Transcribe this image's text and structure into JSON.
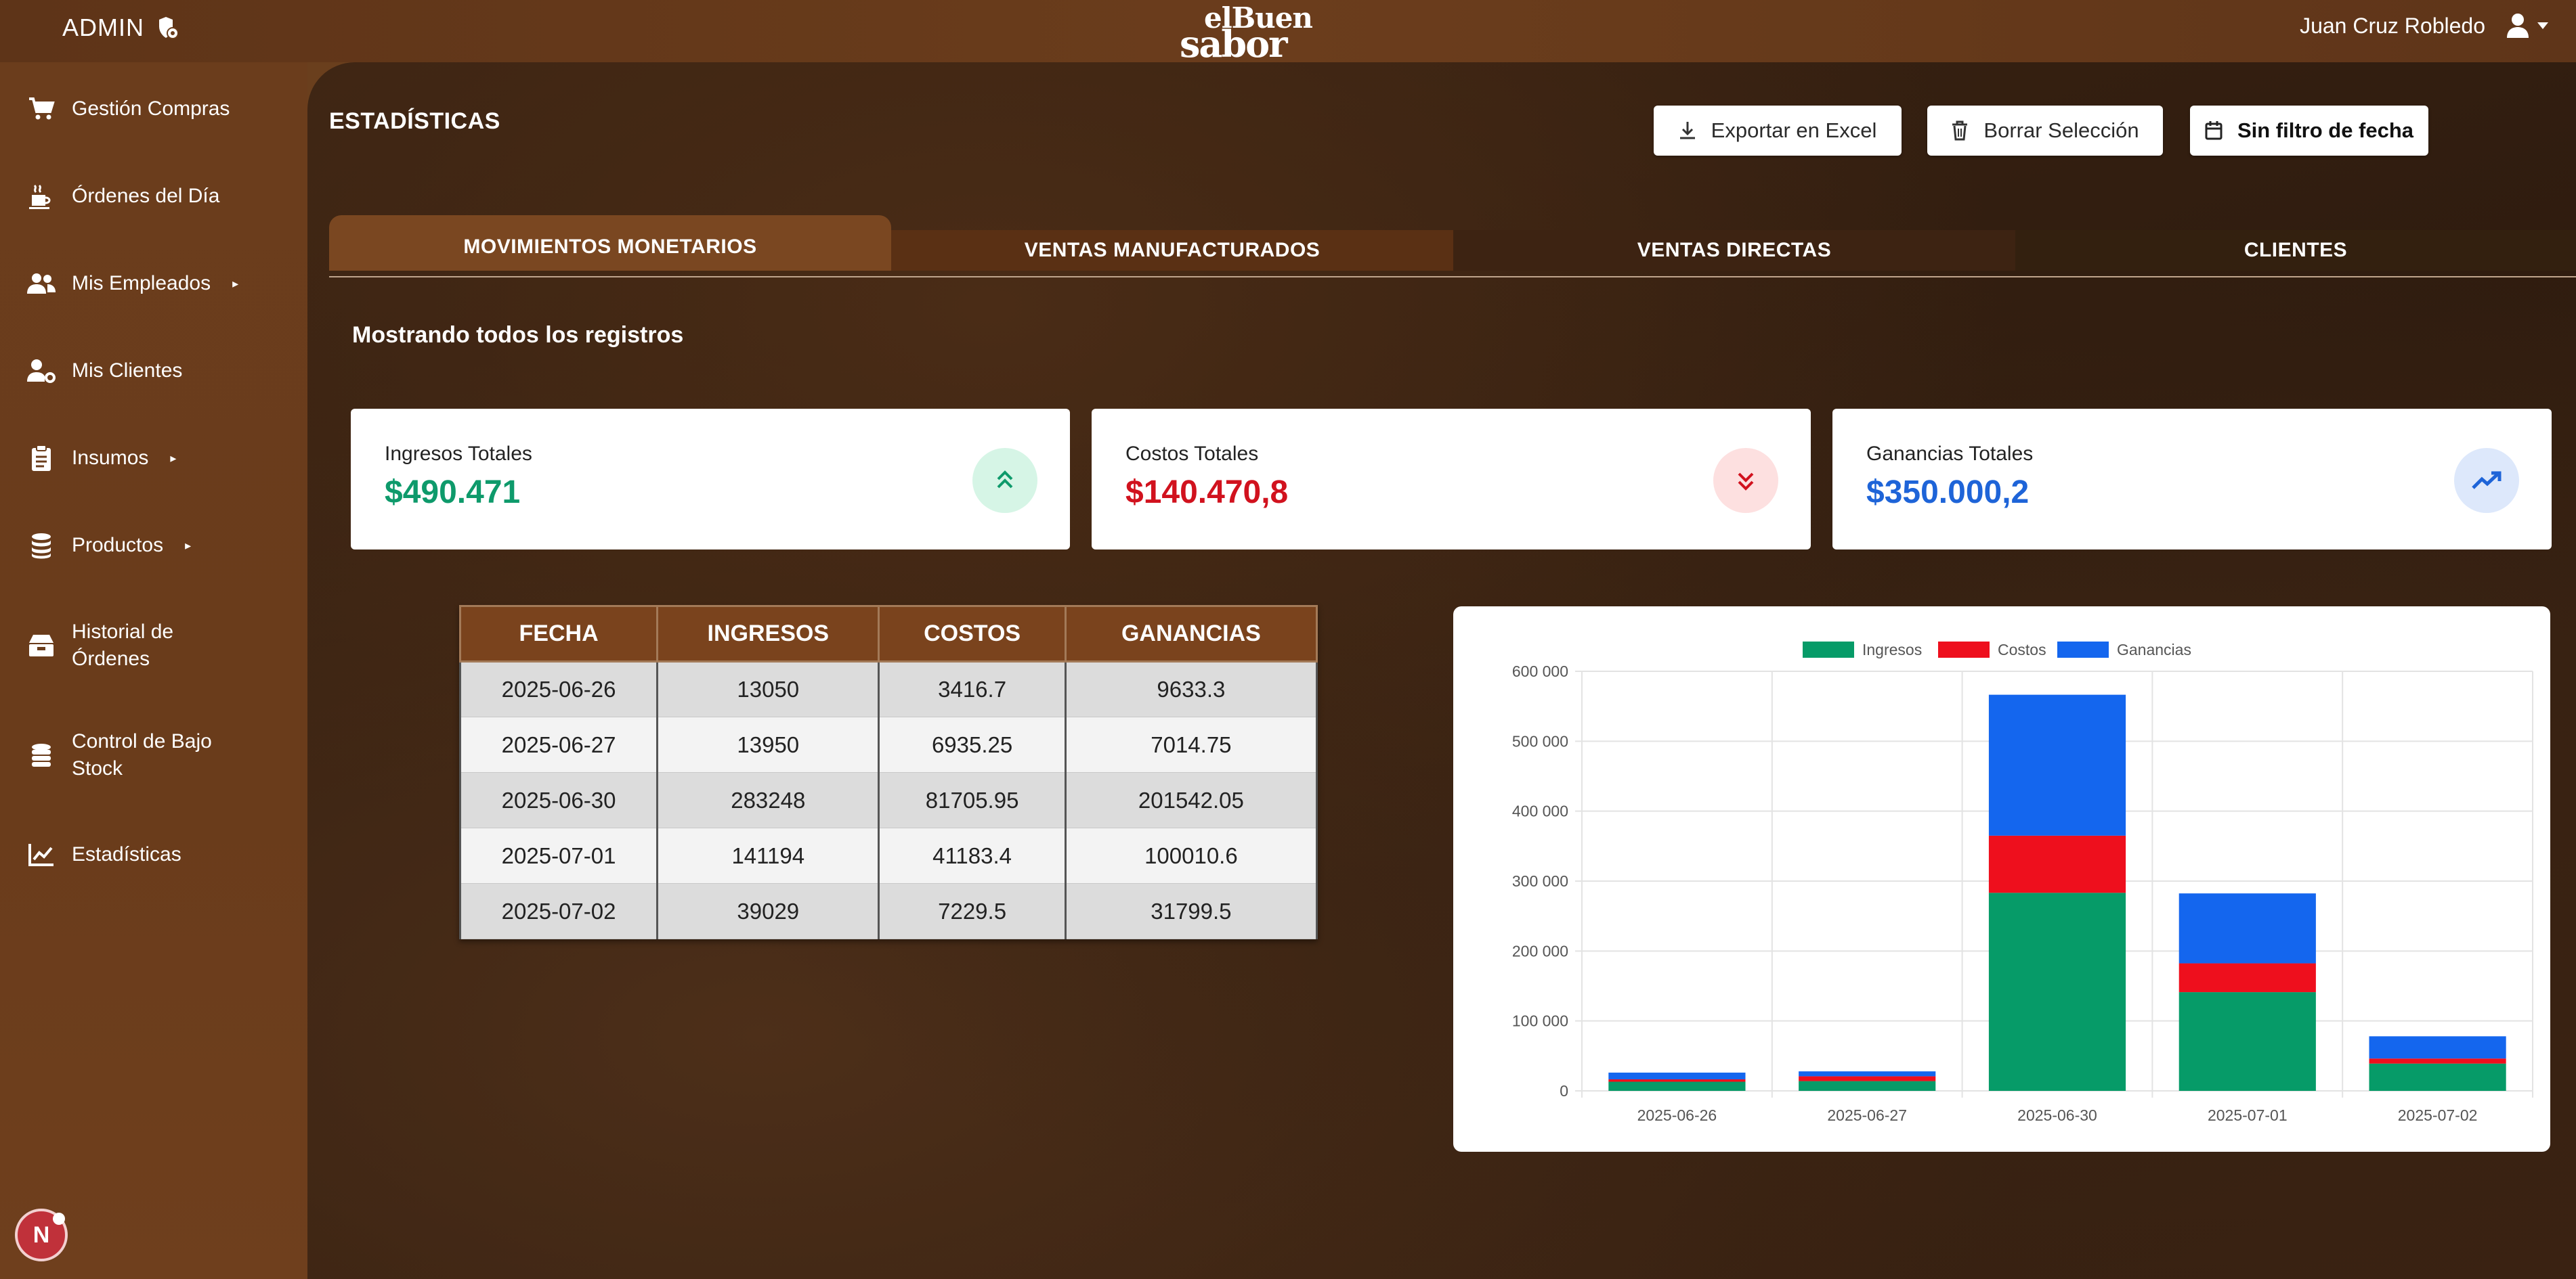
{
  "header": {
    "admin_label": "ADMIN",
    "logo_line1": "elBuen",
    "logo_line2": "sabor",
    "user_name": "Juan Cruz Robledo"
  },
  "sidebar": {
    "items": [
      {
        "label": "Gestión Compras",
        "icon": "cart-icon"
      },
      {
        "label": "Órdenes del Día",
        "icon": "kitchen-icon"
      },
      {
        "label": "Mis Empleados",
        "icon": "users-icon",
        "has_submenu": true
      },
      {
        "label": "Mis Clientes",
        "icon": "user-gear-icon"
      },
      {
        "label": "Insumos",
        "icon": "clipboard-icon",
        "has_submenu": true
      },
      {
        "label": "Productos",
        "icon": "coins-icon",
        "has_submenu": true
      },
      {
        "label": "Historial de Órdenes",
        "icon": "box-icon"
      },
      {
        "label": "Control de Bajo Stock",
        "icon": "stack-icon"
      },
      {
        "label": "Estadísticas",
        "icon": "chart-line-icon"
      }
    ],
    "submenu_arrow": "▸",
    "badge_letter": "N"
  },
  "page": {
    "title": "ESTADÍSTICAS",
    "buttons": {
      "export": "Exportar en Excel",
      "clear": "Borrar Selección",
      "date_filter": "Sin filtro de fecha"
    },
    "tabs": [
      "MOVIMIENTOS MONETARIOS",
      "VENTAS MANUFACTURADOS",
      "VENTAS DIRECTAS",
      "CLIENTES"
    ],
    "showing_text": "Mostrando todos los registros"
  },
  "cards": [
    {
      "label": "Ingresos Totales",
      "value": "$490.471",
      "color": "#0e9a6b",
      "icon_bg": "#d6f5e6",
      "icon": "double-chevron-up-icon"
    },
    {
      "label": "Costos Totales",
      "value": "$140.470,8",
      "color": "#d1121e",
      "icon_bg": "#fde0e0",
      "icon": "double-chevron-down-icon"
    },
    {
      "label": "Ganancias Totales",
      "value": "$350.000,2",
      "color": "#1e64d8",
      "icon_bg": "#dde8fb",
      "icon": "trend-up-icon"
    }
  ],
  "table": {
    "headers": [
      "FECHA",
      "INGRESOS",
      "COSTOS",
      "GANANCIAS"
    ],
    "rows": [
      [
        "2025-06-26",
        "13050",
        "3416.7",
        "9633.3"
      ],
      [
        "2025-06-27",
        "13950",
        "6935.25",
        "7014.75"
      ],
      [
        "2025-06-30",
        "283248",
        "81705.95",
        "201542.05"
      ],
      [
        "2025-07-01",
        "141194",
        "41183.4",
        "100010.6"
      ],
      [
        "2025-07-02",
        "39029",
        "7229.5",
        "31799.5"
      ]
    ]
  },
  "chart_data": {
    "type": "bar",
    "stacked": true,
    "categories": [
      "2025-06-26",
      "2025-06-27",
      "2025-06-30",
      "2025-07-01",
      "2025-07-02"
    ],
    "series": [
      {
        "name": "Ingresos",
        "color": "#069b68",
        "values": [
          13050,
          13950,
          283248,
          141194,
          39029
        ]
      },
      {
        "name": "Costos",
        "color": "#ee0f1d",
        "values": [
          3416.7,
          6935.25,
          81705.95,
          41183.4,
          7229.5
        ]
      },
      {
        "name": "Ganancias",
        "color": "#1466ee",
        "values": [
          9633.3,
          7014.75,
          201542.05,
          100010.6,
          31799.5
        ]
      }
    ],
    "ylim": [
      0,
      600000
    ],
    "yticks": [
      0,
      100000,
      200000,
      300000,
      400000,
      500000,
      600000
    ],
    "ytick_labels": [
      "0",
      "100 000",
      "200 000",
      "300 000",
      "400 000",
      "500 000",
      "600 000"
    ],
    "legend_position": "top-center",
    "grid": true
  }
}
